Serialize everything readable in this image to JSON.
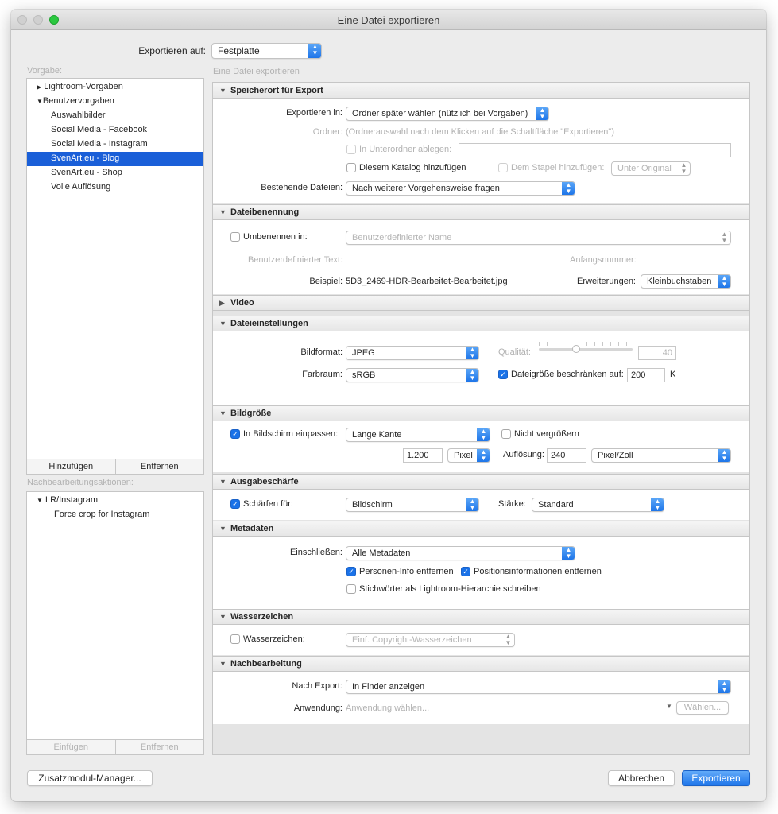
{
  "window": {
    "title": "Eine Datei exportieren"
  },
  "export_to": {
    "label": "Exportieren auf:",
    "value": "Festplatte"
  },
  "presets": {
    "label": "Vorgabe:",
    "items": [
      {
        "label": "Lightroom-Vorgaben",
        "icon": "triangle-right-icon"
      },
      {
        "label": "Benutzervorgaben",
        "icon": "triangle-down-icon"
      },
      {
        "label": "Auswahlbilder"
      },
      {
        "label": "Social Media - Facebook"
      },
      {
        "label": "Social Media - Instagram"
      },
      {
        "label": "SvenArt.eu - Blog",
        "selected": true
      },
      {
        "label": "SvenArt.eu - Shop"
      },
      {
        "label": "Volle Auflösung"
      }
    ],
    "add": "Hinzufügen",
    "remove": "Entfernen"
  },
  "post_actions": {
    "label": "Nachbearbeitungsaktionen:",
    "items": [
      {
        "label": "LR/Instagram",
        "icon": "triangle-down-icon"
      },
      {
        "label": "Force crop for Instagram"
      }
    ],
    "insert": "Einfügen",
    "remove": "Entfernen"
  },
  "right_header": "Eine Datei exportieren",
  "sections": {
    "location": {
      "title": "Speicherort für Export",
      "export_in_label": "Exportieren in:",
      "export_in_value": "Ordner später wählen (nützlich bei Vorgaben)",
      "folder_label": "Ordner:",
      "folder_value": "(Ordnerauswahl nach dem Klicken auf die Schaltfläche \"Exportieren\")",
      "subfolder_label": "In Unterordner ablegen:",
      "add_catalog_label": "Diesem Katalog hinzufügen",
      "add_stack_label": "Dem Stapel hinzufügen:",
      "stack_value": "Unter Original",
      "existing_label": "Bestehende Dateien:",
      "existing_value": "Nach weiterer Vorgehensweise fragen"
    },
    "naming": {
      "title": "Dateibenennung",
      "rename_label": "Umbenennen in:",
      "rename_value": "Benutzerdefinierter Name",
      "custom_text_label": "Benutzerdefinierter Text:",
      "start_number_label": "Anfangsnummer:",
      "example_label": "Beispiel:",
      "example_value": "5D3_2469-HDR-Bearbeitet-Bearbeitet.jpg",
      "extensions_label": "Erweiterungen:",
      "extensions_value": "Kleinbuchstaben"
    },
    "video": {
      "title": "Video"
    },
    "file": {
      "title": "Dateieinstellungen",
      "format_label": "Bildformat:",
      "format_value": "JPEG",
      "quality_label": "Qualität:",
      "quality_value": "40",
      "colorspace_label": "Farbraum:",
      "colorspace_value": "sRGB",
      "limit_label": "Dateigröße beschränken auf:",
      "limit_value": "200",
      "limit_unit": "K"
    },
    "size": {
      "title": "Bildgröße",
      "fit_label": "In Bildschirm einpassen:",
      "fit_value": "Lange Kante",
      "no_enlarge_label": "Nicht vergrößern",
      "size_value": "1.200",
      "unit_value": "Pixel",
      "resolution_label": "Auflösung:",
      "resolution_value": "240",
      "resolution_unit": "Pixel/Zoll"
    },
    "sharpen": {
      "title": "Ausgabeschärfe",
      "sharpen_label": "Schärfen für:",
      "sharpen_value": "Bildschirm",
      "strength_label": "Stärke:",
      "strength_value": "Standard"
    },
    "metadata": {
      "title": "Metadaten",
      "include_label": "Einschließen:",
      "include_value": "Alle Metadaten",
      "remove_person_label": "Personen-Info entfernen",
      "remove_location_label": "Positionsinformationen entfernen",
      "keywords_label": "Stichwörter als Lightroom-Hierarchie schreiben"
    },
    "watermark": {
      "title": "Wasserzeichen",
      "watermark_label": "Wasserzeichen:",
      "watermark_value": "Einf. Copyright-Wasserzeichen"
    },
    "post": {
      "title": "Nachbearbeitung",
      "after_label": "Nach Export:",
      "after_value": "In Finder anzeigen",
      "app_label": "Anwendung:",
      "app_placeholder": "Anwendung wählen...",
      "choose": "Wählen..."
    }
  },
  "footer": {
    "plugin_manager": "Zusatzmodul-Manager...",
    "cancel": "Abbrechen",
    "export": "Exportieren"
  }
}
